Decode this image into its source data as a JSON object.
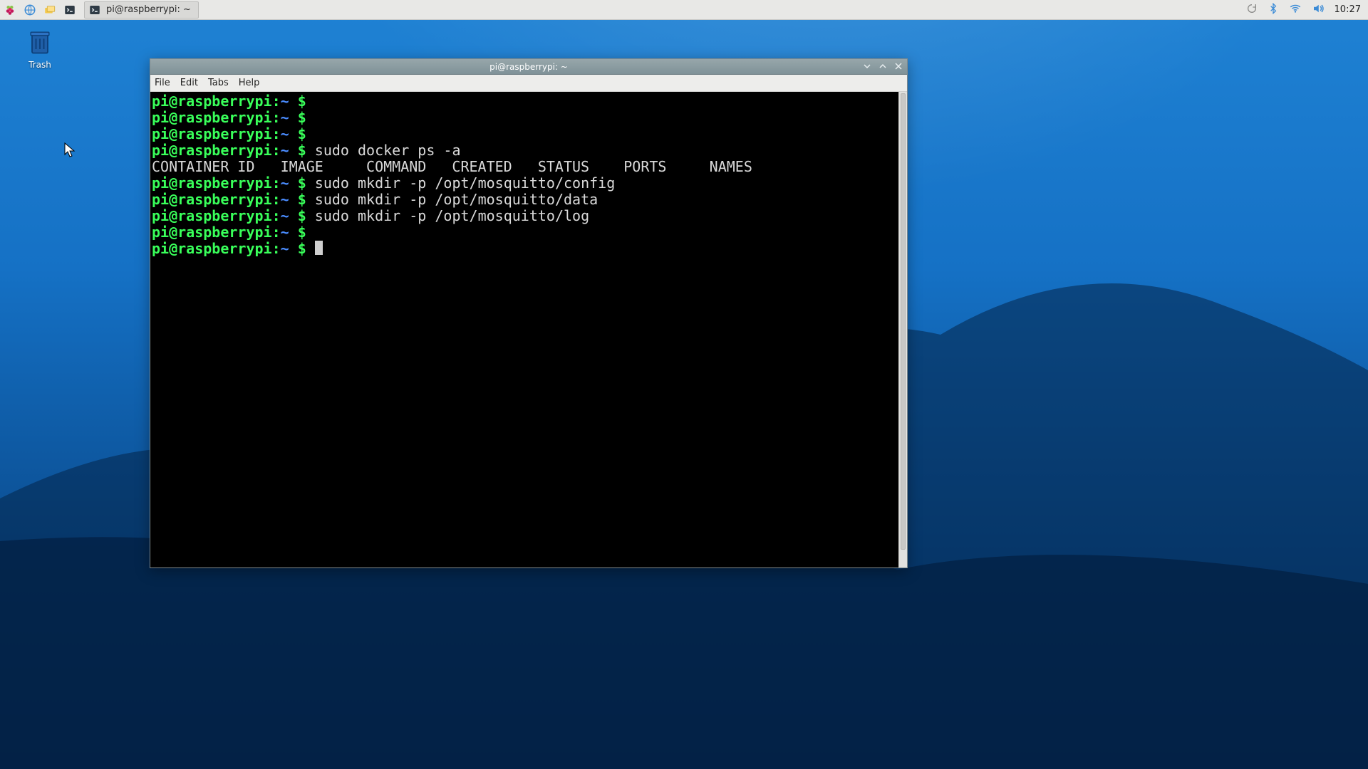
{
  "panel": {
    "task_title": "pi@raspberrypi: ~",
    "clock": "10:27"
  },
  "desktop": {
    "trash_label": "Trash"
  },
  "window": {
    "title": "pi@raspberrypi: ~",
    "menus": {
      "file": "File",
      "edit": "Edit",
      "tabs": "Tabs",
      "help": "Help"
    }
  },
  "terminal": {
    "prompt": {
      "user": "pi@raspberrypi",
      "sep": ":",
      "path": "~",
      "symbol": " $ "
    },
    "lines": [
      {
        "cmd": ""
      },
      {
        "cmd": ""
      },
      {
        "cmd": ""
      },
      {
        "cmd": "sudo docker ps -a"
      },
      {
        "header": "CONTAINER ID   IMAGE     COMMAND   CREATED   STATUS    PORTS     NAMES"
      },
      {
        "cmd": "sudo mkdir -p /opt/mosquitto/config"
      },
      {
        "cmd": "sudo mkdir -p /opt/mosquitto/data"
      },
      {
        "cmd": "sudo mkdir -p /opt/mosquitto/log"
      },
      {
        "cmd": ""
      },
      {
        "cmd": "",
        "cursor": true
      }
    ]
  }
}
